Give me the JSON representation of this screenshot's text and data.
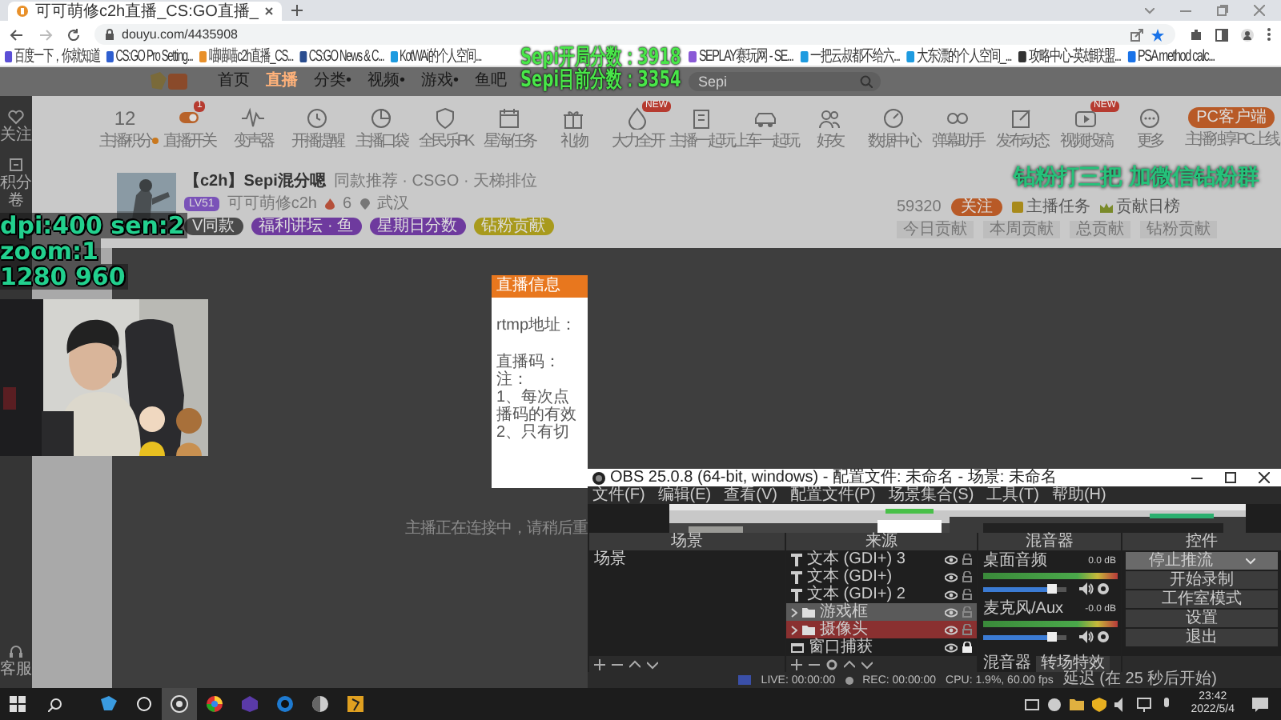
{
  "browser": {
    "tab_title": "可可萌修c2h直播_CS:GO直播_",
    "url": "douyu.com/4435908",
    "bookmarks": [
      "百度一下，你就知道",
      "CS:GO Pro Setting...",
      "喵喵喵c2h直播_CS...",
      "CS:GO News & C...",
      "KotWAi的个人空间...",
      "SEPLAY赛玩网 - SE...",
      "一把云叔都不给六...",
      "大东漂的个人空间_...",
      "攻略中心-英雄联盟...",
      "PSA method calc..."
    ]
  },
  "site": {
    "nav": [
      {
        "label": "首页",
        "selected": false
      },
      {
        "label": "直播",
        "selected": true
      },
      {
        "label": "分类•",
        "selected": false
      },
      {
        "label": "视频•",
        "selected": false
      },
      {
        "label": "游戏•",
        "selected": false
      },
      {
        "label": "鱼吧",
        "selected": false
      }
    ],
    "search": {
      "placeholder": "Sepi"
    },
    "tools": [
      {
        "label": "主播积分",
        "kind": "count",
        "count": "12"
      },
      {
        "label": "直播开关",
        "kind": "icon",
        "badge": "1"
      },
      {
        "label": "变声器",
        "kind": "icon"
      },
      {
        "label": "开播提醒",
        "kind": "icon"
      },
      {
        "label": "主播口袋",
        "kind": "icon"
      },
      {
        "label": "全民乐PK",
        "kind": "icon"
      },
      {
        "label": "星海任务",
        "kind": "icon"
      },
      {
        "label": "礼物",
        "kind": "icon"
      },
      {
        "label": "大力全开",
        "kind": "icon",
        "badge": "NEW"
      },
      {
        "label": "主播一起玩",
        "kind": "icon"
      },
      {
        "label": "上车一起玩",
        "kind": "icon"
      },
      {
        "label": "好友",
        "kind": "icon"
      },
      {
        "label": "数据中心",
        "kind": "icon"
      },
      {
        "label": "弹幕助手",
        "kind": "icon"
      },
      {
        "label": "发布动态",
        "kind": "icon"
      },
      {
        "label": "视频投稿",
        "kind": "icon",
        "badge": "NEW"
      },
      {
        "label": "更多",
        "kind": "icon"
      }
    ],
    "client_button": "PC客户端",
    "client_note": "主播独享PC上线",
    "sidebar": [
      "关注",
      "积分卷",
      "客服"
    ]
  },
  "room": {
    "title": "【c2h】Sepi混分嗯",
    "category": "同款推荐 · CSGO · 天梯排位",
    "level": "LV51",
    "streamer": "可可萌修c2h",
    "heat": "6",
    "location": "武汉",
    "tags": [
      {
        "label": "V同款",
        "color": "#4a4a4a"
      },
      {
        "label": "福利讲坛 · 鱼",
        "color": "#6e3a9e"
      },
      {
        "label": "星期日分数",
        "color": "#6e3a9e"
      },
      {
        "label": "钻粉贡献",
        "color": "#a89a1c"
      }
    ],
    "followers": "59320",
    "follow_button": "关注",
    "task": "主播任务",
    "rank_title": "贡献日榜",
    "rank_tabs": [
      "今日贡献",
      "本周贡献",
      "总贡献",
      "钻粉贡献"
    ]
  },
  "player": {
    "dialog": {
      "title": "直播信息",
      "lines": [
        "rtmp地址：",
        "直播码：",
        "注：",
        "1、每次点",
        "播码的有效",
        "2、只有切"
      ]
    },
    "status": "主播正在连接中，请稍后重"
  },
  "overlays": {
    "scores": [
      "Sepi开局分数：3918",
      "Sepi目前分数：3354"
    ],
    "promo": "钻粉打三把 加微信钻粉群",
    "settings": [
      "dpi:400 sen:2",
      "zoom:1",
      "1280 960"
    ]
  },
  "obs": {
    "title": "OBS 25.0.8 (64-bit, windows) - 配置文件: 未命名 - 场景: 未命名",
    "menu": [
      "文件(F)",
      "编辑(E)",
      "查看(V)",
      "配置文件(P)",
      "场景集合(S)",
      "工具(T)",
      "帮助(H)"
    ],
    "scenes": {
      "title": "场景",
      "items": [
        {
          "label": "场景",
          "selected": false
        }
      ]
    },
    "sources": {
      "title": "来源",
      "items": [
        {
          "label": "文本 (GDI+) 3",
          "kind": "text",
          "selected": false,
          "hovered": false,
          "visible": true,
          "locked": false
        },
        {
          "label": "文本 (GDI+)",
          "kind": "text",
          "selected": false,
          "hovered": false,
          "visible": true,
          "locked": false
        },
        {
          "label": "文本 (GDI+) 2",
          "kind": "text",
          "selected": false,
          "hovered": false,
          "visible": true,
          "locked": false
        },
        {
          "label": "游戏框",
          "kind": "group",
          "selected": false,
          "hovered": true,
          "visible": true,
          "locked": false
        },
        {
          "label": "摄像头",
          "kind": "group",
          "selected": true,
          "hovered": false,
          "visible": true,
          "locked": false
        },
        {
          "label": "窗口捕获",
          "kind": "window",
          "selected": false,
          "hovered": false,
          "visible": true,
          "locked": true
        }
      ]
    },
    "mixer": {
      "title": "混音器",
      "channels": [
        {
          "name": "桌面音频",
          "reading": "0.0 dB",
          "level": 0.82
        },
        {
          "name": "麦克风/Aux",
          "reading": "-0.0 dB",
          "level": 0.82
        }
      ],
      "tabs": [
        {
          "label": "混音器",
          "selected": true
        },
        {
          "label": "转场特效",
          "selected": false
        }
      ]
    },
    "controls": {
      "title": "控件",
      "buttons": [
        {
          "label": "停止推流",
          "kind": "dropdown"
        },
        {
          "label": "开始录制",
          "kind": "button"
        },
        {
          "label": "工作室模式",
          "kind": "button"
        },
        {
          "label": "设置",
          "kind": "button"
        },
        {
          "label": "退出",
          "kind": "button"
        }
      ]
    },
    "status": {
      "live": "LIVE: 00:00:00",
      "rec": "REC: 00:00:00",
      "cpu": "CPU: 1.9%, 60.00 fps",
      "delay": "延迟 (在 25 秒后开始)"
    }
  },
  "taskbar": {
    "apps": [
      {
        "selected": false
      },
      {
        "selected": false
      },
      {
        "selected": true
      },
      {
        "selected": false
      },
      {
        "selected": false
      },
      {
        "selected": false
      },
      {
        "selected": false
      },
      {
        "selected": false
      }
    ],
    "time": "23:42",
    "date": "2022/5/4"
  }
}
